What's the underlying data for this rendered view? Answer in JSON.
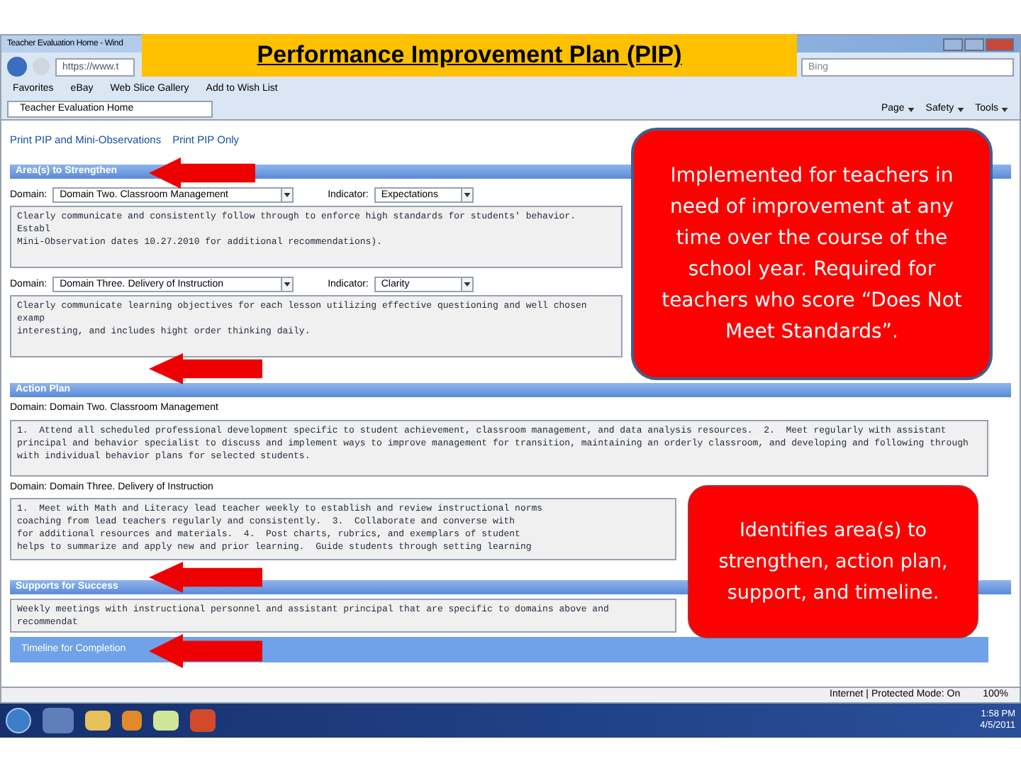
{
  "slide_title": "Performance Improvement Plan (PIP)",
  "browser": {
    "window_title": "Teacher Evaluation Home - Wind",
    "address": "https://www.t",
    "search": {
      "placeholder": "Bing"
    },
    "favorites": [
      "Favorites",
      "eBay",
      "Web Slice Gallery",
      "Add to Wish List"
    ],
    "tab": "Teacher Evaluation Home",
    "tools": [
      "Page",
      "Safety",
      "Tools"
    ],
    "status": {
      "zone": "Internet | Protected Mode: On",
      "zoom": "100%"
    }
  },
  "page": {
    "links": [
      "Print PIP and Mini-Observations",
      "Print PIP Only"
    ],
    "areas": {
      "header": "Area(s) to Strengthen",
      "items": [
        {
          "domain_label": "Domain:",
          "domain": "Domain Two. Classroom Management",
          "indicator_label": "Indicator:",
          "indicator": "Expectations",
          "text": "Clearly communicate and consistently follow through to enforce high standards for students' behavior.  Establ\nMini-Observation dates 10.27.2010 for additional recommendations)."
        },
        {
          "domain_label": "Domain:",
          "domain": "Domain Three. Delivery of Instruction",
          "indicator_label": "Indicator:",
          "indicator": "Clarity",
          "text": "Clearly communicate learning objectives for each lesson utilizing effective questioning and well chosen examp\ninteresting, and includes hight order thinking daily."
        }
      ]
    },
    "action_plan": {
      "header": "Action Plan",
      "items": [
        {
          "domain": "Domain: Domain Two. Classroom Management",
          "text": "1.  Attend all scheduled professional development specific to student achievement, classroom management, and data analysis resources.  2.  Meet regularly with assistant principal and behavior specialist to discuss and implement ways to improve management for transition, maintaining an orderly classroom, and developing and following through with individual behavior plans for selected students."
        },
        {
          "domain": "Domain: Domain Three. Delivery of Instruction",
          "text": "1.  Meet with Math and Literacy lead teacher weekly to establish and review instructional norms\ncoaching from lead teachers regularly and consistently.  3.  Collaborate and converse with\nfor additional resources and materials.  4.  Post charts, rubrics, and exemplars of student\nhelps to summarize and apply new and prior learning.  Guide students through setting learning"
        }
      ]
    },
    "supports": {
      "header": "Supports for Success",
      "text": "Weekly meetings with instructional personnel and assistant principal that are specific to domains above and recommendat"
    },
    "timeline": {
      "header": "Timeline for Completion"
    }
  },
  "taskbar": {
    "time": "1:58 PM",
    "date": "4/5/2011"
  },
  "callouts": [
    "Implemented for teachers in need of improvement at any time over the course of the school year.  Required for teachers who score “Does Not Meet Standards”.",
    "Identifies area(s) to strengthen, action plan, support, and timeline."
  ]
}
